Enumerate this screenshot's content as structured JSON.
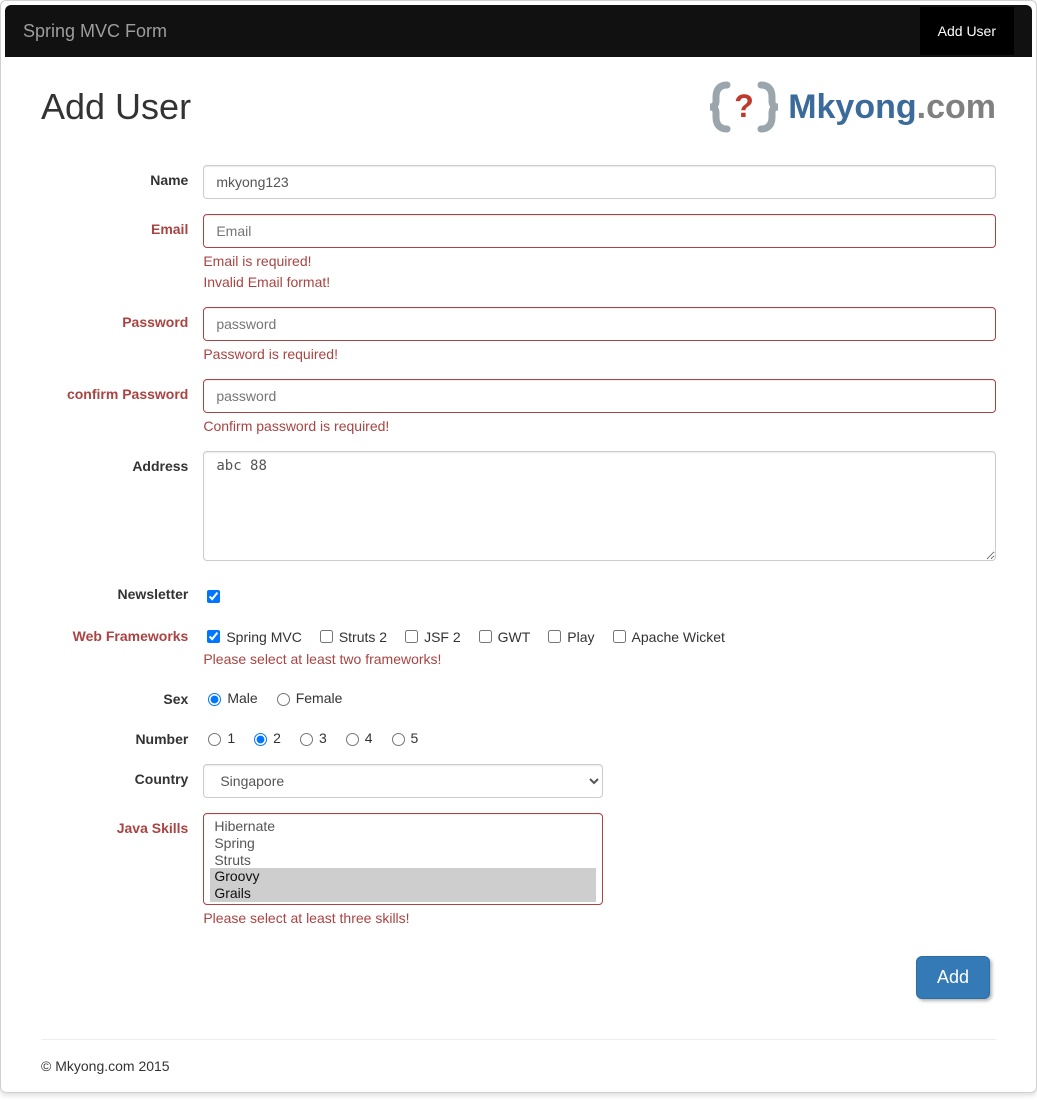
{
  "navbar": {
    "brand": "Spring MVC Form",
    "active_item": "Add User"
  },
  "header": {
    "title": "Add User",
    "logo_mkyong": "Mkyong",
    "logo_dotcom": ".com"
  },
  "form": {
    "name": {
      "label": "Name",
      "value": "mkyong123"
    },
    "email": {
      "label": "Email",
      "placeholder": "Email",
      "errors": [
        "Email is required!",
        "Invalid Email format!"
      ]
    },
    "password": {
      "label": "Password",
      "placeholder": "password",
      "errors": [
        "Password is required!"
      ]
    },
    "confirm": {
      "label": "confirm Password",
      "placeholder": "password",
      "errors": [
        "Confirm password is required!"
      ]
    },
    "address": {
      "label": "Address",
      "value": "abc 88"
    },
    "newsletter": {
      "label": "Newsletter",
      "checked": true
    },
    "frameworks": {
      "label": "Web Frameworks",
      "options": [
        "Spring MVC",
        "Struts 2",
        "JSF 2",
        "GWT",
        "Play",
        "Apache Wicket"
      ],
      "checked": [
        "Spring MVC"
      ],
      "errors": [
        "Please select at least two frameworks!"
      ]
    },
    "sex": {
      "label": "Sex",
      "options": [
        "Male",
        "Female"
      ],
      "selected": "Male"
    },
    "number": {
      "label": "Number",
      "options": [
        "1",
        "2",
        "3",
        "4",
        "5"
      ],
      "selected": "2"
    },
    "country": {
      "label": "Country",
      "selected": "Singapore"
    },
    "javaskills": {
      "label": "Java Skills",
      "options": [
        "Hibernate",
        "Spring",
        "Struts",
        "Groovy",
        "Grails"
      ],
      "selected": [
        "Groovy",
        "Grails"
      ],
      "errors": [
        "Please select at least three skills!"
      ]
    },
    "submit": "Add"
  },
  "footer": "© Mkyong.com 2015"
}
